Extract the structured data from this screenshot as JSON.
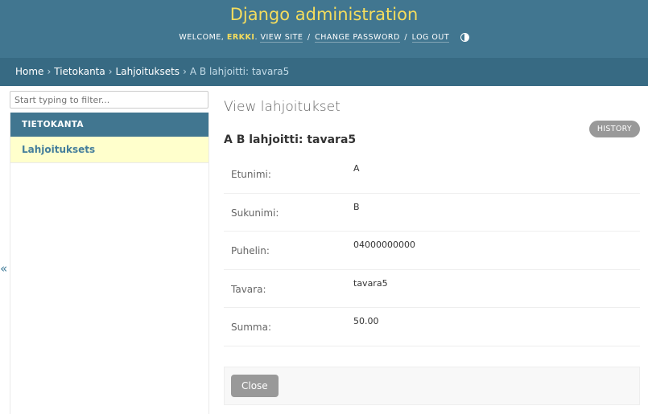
{
  "header": {
    "brand": "Django administration",
    "welcome": "WELCOME,",
    "username": "ERKKI",
    "view_site": "VIEW SITE",
    "change_password": "CHANGE PASSWORD",
    "log_out": "LOG OUT",
    "separator": "/",
    "theme_icon": "contrast-icon"
  },
  "breadcrumbs": {
    "home": "Home",
    "app": "Tietokanta",
    "model": "Lahjoituksets",
    "current": "A B lahjoitti: tavara5",
    "sep": "›"
  },
  "sidebar": {
    "filter_placeholder": "Start typing to filter...",
    "caption": "TIETOKANTA",
    "items": [
      {
        "label": "Lahjoituksets"
      }
    ],
    "collapse": "«"
  },
  "main": {
    "title": "View lahjoitukset",
    "history": "HISTORY",
    "object_title": "A B lahjoitti: tavara5",
    "fields": [
      {
        "label": "Etunimi:",
        "value": "A"
      },
      {
        "label": "Sukunimi:",
        "value": "B"
      },
      {
        "label": "Puhelin:",
        "value": "04000000000"
      },
      {
        "label": "Tavara:",
        "value": "tavara5"
      },
      {
        "label": "Summa:",
        "value": "50.00"
      }
    ],
    "close": "Close"
  }
}
